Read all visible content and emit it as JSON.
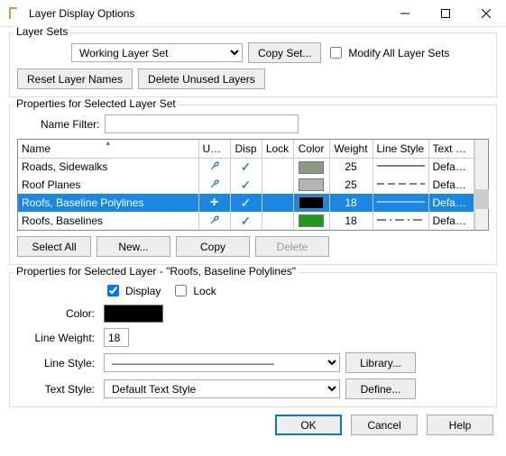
{
  "window": {
    "title": "Layer Display Options"
  },
  "layerSets": {
    "legend": "Layer Sets",
    "selected": "Working Layer Set",
    "copySet": "Copy Set...",
    "modifyAll": "Modify All Layer Sets",
    "resetNames": "Reset Layer Names",
    "deleteUnused": "Delete Unused Layers"
  },
  "setProps": {
    "legend": "Properties for Selected Layer Set",
    "nameFilterLabel": "Name Filter:",
    "nameFilterValue": "",
    "headers": {
      "name": "Name",
      "used": "Used",
      "disp": "Disp",
      "lock": "Lock",
      "color": "Color",
      "weight": "Weight",
      "lineStyle": "Line Style",
      "textStyle": "Text Style"
    },
    "rows": [
      {
        "name": "Roads, Sidewalks",
        "used": "wrench",
        "disp": true,
        "lock": false,
        "color": "#8a9a82",
        "weight": "25",
        "lineStyle": "solid",
        "textStyle": "Default Te...",
        "selected": false
      },
      {
        "name": "Roof Planes",
        "used": "wrench",
        "disp": true,
        "lock": false,
        "color": "#b4b4b4",
        "weight": "25",
        "lineStyle": "dashed",
        "textStyle": "Default Te...",
        "selected": false
      },
      {
        "name": "Roofs, Baseline Polylines",
        "used": "plus",
        "disp": true,
        "lock": false,
        "color": "#000000",
        "weight": "18",
        "lineStyle": "solid",
        "textStyle": "Default Te...",
        "selected": true
      },
      {
        "name": "Roofs, Baselines",
        "used": "wrench",
        "disp": true,
        "lock": false,
        "color": "#1f9a1f",
        "weight": "18",
        "lineStyle": "dashdot",
        "textStyle": "Default Te...",
        "selected": false
      }
    ],
    "buttons": {
      "selectAll": "Select All",
      "new": "New...",
      "copy": "Copy",
      "delete": "Delete"
    }
  },
  "layerProps": {
    "legend": "Properties for Selected Layer - \"Roofs, Baseline Polylines\"",
    "displayLabel": "Display",
    "displayChecked": true,
    "lockLabel": "Lock",
    "lockChecked": false,
    "colorLabel": "Color:",
    "colorValue": "#000000",
    "weightLabel": "Line Weight:",
    "weightValue": "18",
    "lineStyleLabel": "Line Style:",
    "lineStyleValue": "———————————————",
    "libraryBtn": "Library...",
    "textStyleLabel": "Text Style:",
    "textStyleValue": "Default Text Style",
    "defineBtn": "Define..."
  },
  "footer": {
    "ok": "OK",
    "cancel": "Cancel",
    "help": "Help"
  }
}
